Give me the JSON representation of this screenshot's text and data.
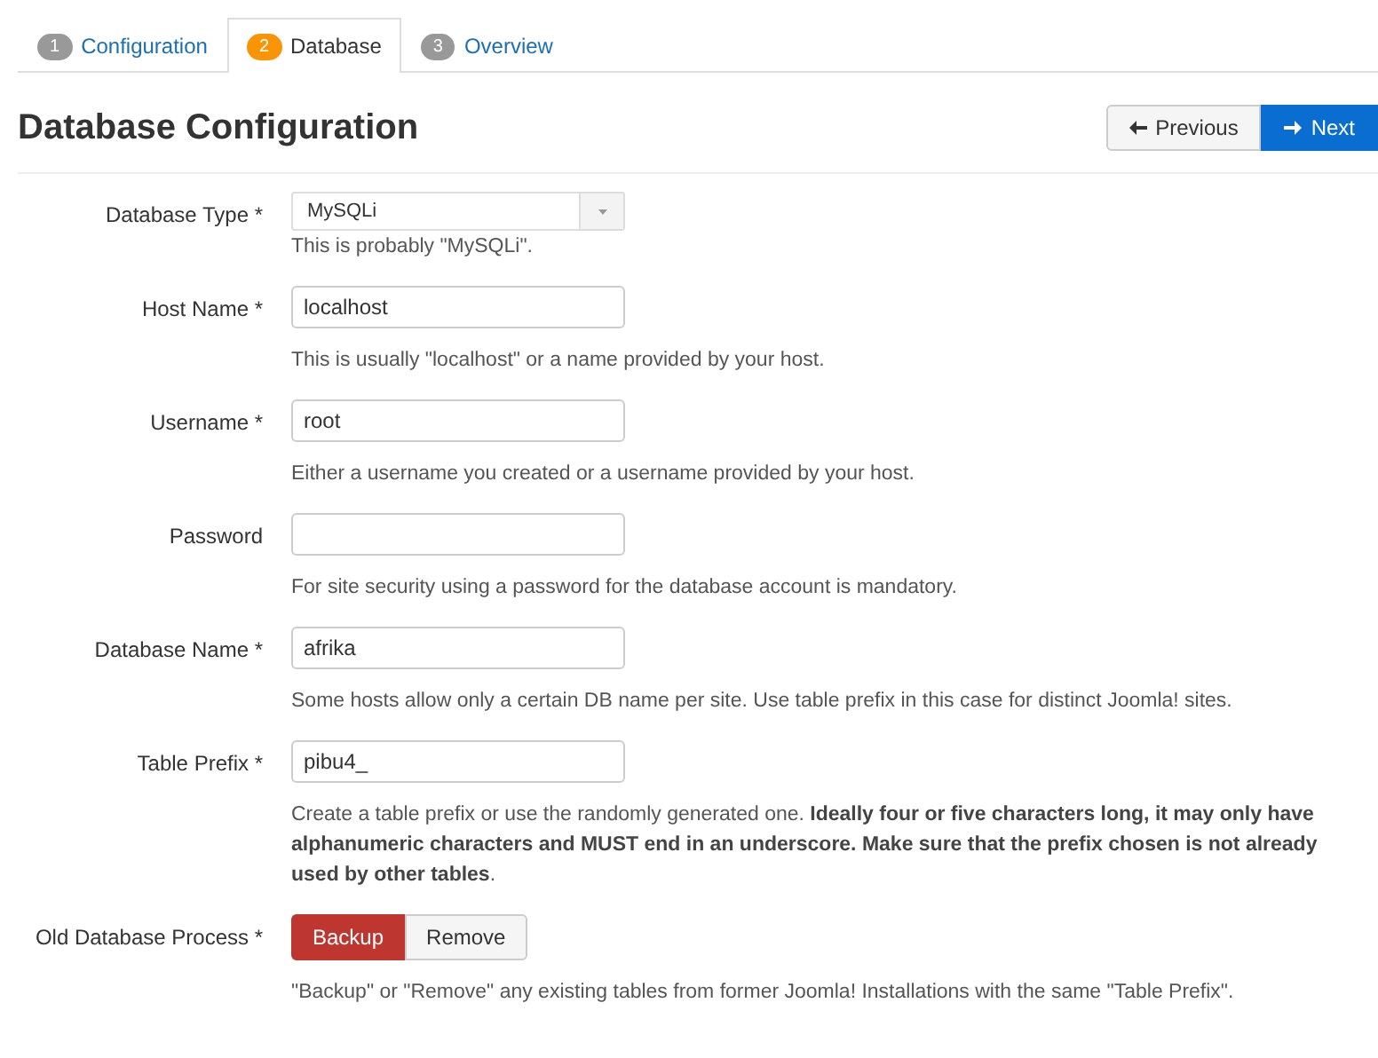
{
  "tabs": [
    {
      "number": "1",
      "label": "Configuration",
      "selected": false
    },
    {
      "number": "2",
      "label": "Database",
      "selected": true
    },
    {
      "number": "3",
      "label": "Overview",
      "selected": false
    }
  ],
  "heading": "Database Configuration",
  "nav_buttons": [
    {
      "kind": "previous",
      "label": "Previous"
    },
    {
      "kind": "next",
      "label": "Next"
    }
  ],
  "fields": [
    {
      "kind": "select",
      "label": "Database Type *",
      "value": "MySQLi",
      "help": [
        "This is probably \"MySQLi\"."
      ]
    },
    {
      "kind": "text",
      "label": "Host Name *",
      "value": "localhost",
      "help": [
        "This is usually \"localhost\" or a name provided by your host."
      ]
    },
    {
      "kind": "text",
      "label": "Username *",
      "value": "root",
      "help": [
        "Either a username you created or a username provided by your host."
      ]
    },
    {
      "kind": "text",
      "label": "Password",
      "help": [
        "For site security using a password for the database account is mandatory."
      ]
    },
    {
      "kind": "text",
      "label": "Database Name *",
      "value": "afrika",
      "help": [
        "Some hosts allow only a certain DB name per site. Use table prefix in this case for distinct Joomla! sites."
      ]
    },
    {
      "kind": "text",
      "label": "Table Prefix *",
      "value": "pibu4_",
      "help": [
        "Create a table prefix or use the randomly generated one. **Ideally four or five characters long, it may only have alphanumeric characters and MUST end in an underscore. Make sure that the prefix chosen is not already used by other tables**."
      ]
    },
    {
      "kind": "toggle",
      "label": "Old Database Process *",
      "options": [
        {
          "label": "Backup",
          "selected": true
        },
        {
          "label": "Remove",
          "selected": false
        }
      ],
      "help": [
        "\"Backup\" or \"Remove\" any existing tables from former Joomla! Installations with the same \"Table Prefix\"."
      ]
    }
  ]
}
